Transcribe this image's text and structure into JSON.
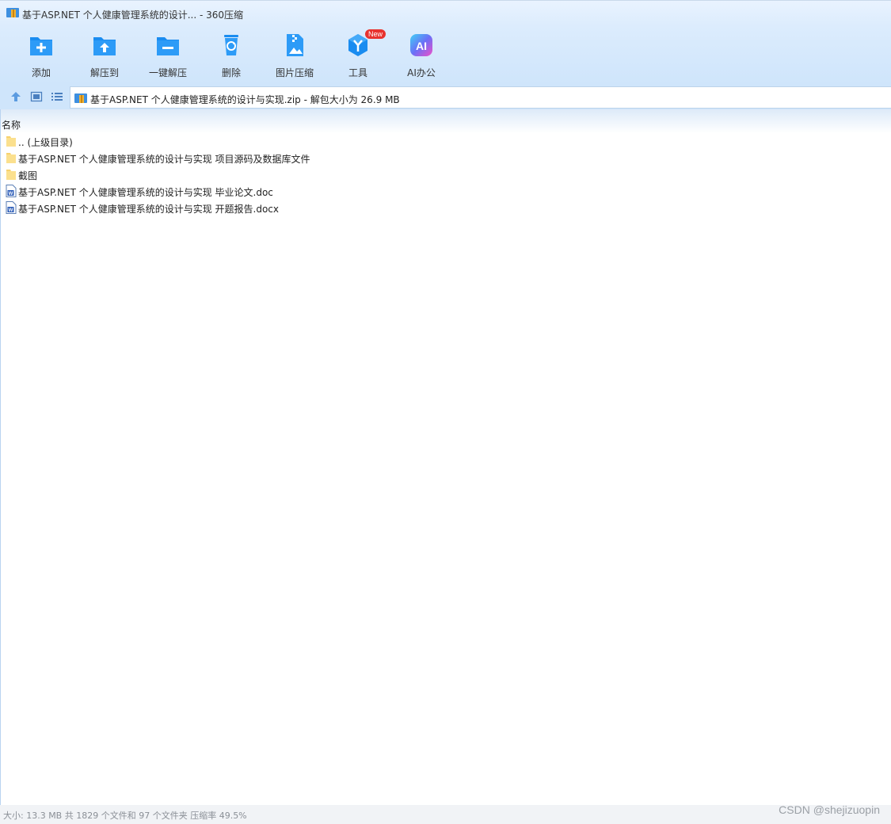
{
  "window": {
    "title": "基于ASP.NET 个人健康管理系统的设计... - 360压缩"
  },
  "toolbar": {
    "items": [
      {
        "label": "添加",
        "icon": "add-folder-icon"
      },
      {
        "label": "解压到",
        "icon": "extract-to-icon"
      },
      {
        "label": "一键解压",
        "icon": "one-click-extract-icon"
      },
      {
        "label": "删除",
        "icon": "recycle-bin-icon"
      },
      {
        "label": "图片压缩",
        "icon": "image-compress-icon"
      },
      {
        "label": "工具",
        "icon": "tools-icon",
        "badge": "New"
      },
      {
        "label": "AI办公",
        "icon": "ai-office-icon"
      }
    ]
  },
  "address": {
    "text": "基于ASP.NET 个人健康管理系统的设计与实现.zip - 解包大小为 26.9 MB"
  },
  "list": {
    "column_header": "名称",
    "items": [
      {
        "name": ".. (上级目录)",
        "type": "folder"
      },
      {
        "name": "基于ASP.NET 个人健康管理系统的设计与实现 项目源码及数据库文件",
        "type": "folder"
      },
      {
        "name": "截图",
        "type": "folder"
      },
      {
        "name": "基于ASP.NET 个人健康管理系统的设计与实现 毕业论文.doc",
        "type": "word"
      },
      {
        "name": "基于ASP.NET 个人健康管理系统的设计与实现 开题报告.docx",
        "type": "word"
      }
    ]
  },
  "status": {
    "text": "大小: 13.3 MB 共 1829 个文件和 97 个文件夹 压缩率 49.5%"
  },
  "watermark": "CSDN @shejizuopin",
  "colors": {
    "accent": "#1a8cf0",
    "folder": "#f7d26e",
    "badge": "#e8322e",
    "toolbar_bg": "#cfe5fb"
  }
}
